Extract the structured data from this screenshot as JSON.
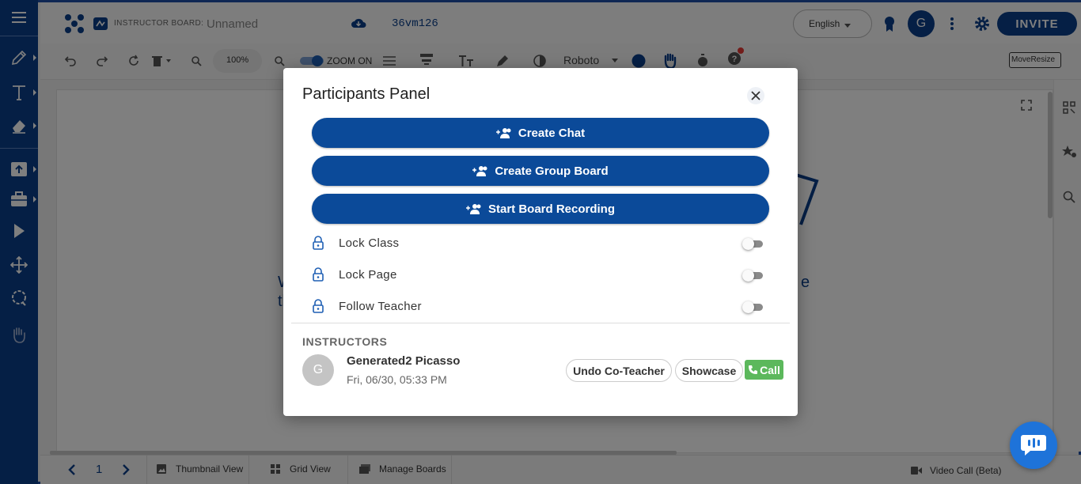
{
  "topbar": {
    "board_label": "INSTRUCTOR BOARD:",
    "board_name": "Unnamed",
    "session_code": "36vm126",
    "language": "English",
    "avatar_initial": "G",
    "invite_label": "INVITE"
  },
  "toolbar": {
    "zoom_level": "100%",
    "zoom_toggle_label": "ZOOM ON",
    "font_name": "Roboto",
    "move_resize_label": "MoveResize"
  },
  "canvas": {
    "partial_text_left_1": "W",
    "partial_text_left_2": "th",
    "partial_text_right": "e"
  },
  "bottombar": {
    "page_number": "1",
    "thumbnail_view": "Thumbnail View",
    "grid_view": "Grid View",
    "manage_boards": "Manage Boards",
    "video_call": "Video Call (Beta)"
  },
  "modal": {
    "title": "Participants Panel",
    "actions": [
      {
        "label": "Create Chat"
      },
      {
        "label": "Create Group Board"
      },
      {
        "label": "Start Board Recording"
      }
    ],
    "options": [
      {
        "label": "Lock Class"
      },
      {
        "label": "Lock Page"
      },
      {
        "label": "Follow Teacher"
      }
    ],
    "section_title": "INSTRUCTORS",
    "participant": {
      "initial": "G",
      "name": "Generated2 Picasso",
      "time": "Fri, 06/30, 05:33 PM",
      "undo_label": "Undo Co-Teacher",
      "showcase_label": "Showcase",
      "call_label": "Call"
    }
  },
  "colors": {
    "brand": "#0b3f8a",
    "action_button": "#0b4a99",
    "call_green": "#5cb85c",
    "chat_fab": "#1e73d9"
  }
}
